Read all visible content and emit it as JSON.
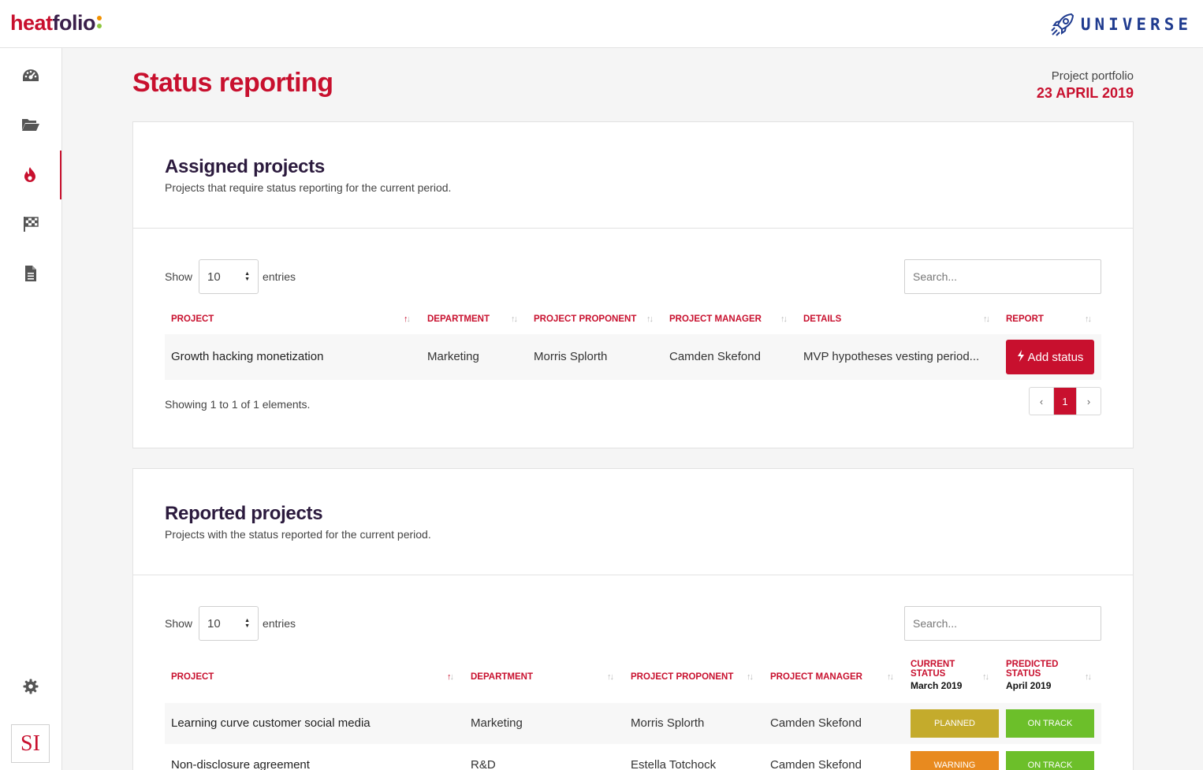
{
  "app": {
    "brand_a": "heat",
    "brand_b": "folio",
    "partner": "UNIVERSE",
    "accent": "#c8102e"
  },
  "sidebar": {
    "items": [
      {
        "icon": "dashboard-icon"
      },
      {
        "icon": "folder-icon"
      },
      {
        "icon": "fire-icon",
        "active": true
      },
      {
        "icon": "flag-icon"
      },
      {
        "icon": "document-icon"
      }
    ],
    "settings_icon": "gear-icon",
    "avatar_initials": "SI"
  },
  "header": {
    "title": "Status reporting",
    "portfolio_label": "Project portfolio",
    "date": "23 APRIL 2019"
  },
  "assigned": {
    "title": "Assigned projects",
    "subtitle": "Projects that require status reporting for the current period.",
    "show_label": "Show",
    "page_size": "10",
    "entries_label": "entries",
    "search_placeholder": "Search...",
    "columns": [
      "PROJECT",
      "DEPARTMENT",
      "PROJECT PROPONENT",
      "PROJECT MANAGER",
      "DETAILS",
      "REPORT"
    ],
    "rows": [
      {
        "project": "Growth hacking monetization",
        "department": "Marketing",
        "proponent": "Morris Splorth",
        "manager": "Camden Skefond",
        "details": "MVP hypotheses vesting period...",
        "action": "Add status"
      }
    ],
    "info": "Showing 1 to 1 of 1 elements.",
    "pager": {
      "prev": "‹",
      "page": "1",
      "next": "›"
    }
  },
  "reported": {
    "title": "Reported projects",
    "subtitle": "Projects with the status reported for the current period.",
    "show_label": "Show",
    "page_size": "10",
    "entries_label": "entries",
    "search_placeholder": "Search...",
    "columns": {
      "project": "PROJECT",
      "department": "DEPARTMENT",
      "proponent": "PROJECT PROPONENT",
      "manager": "PROJECT MANAGER",
      "current_a": "CURRENT",
      "current_b": "STATUS",
      "current_period": "March 2019",
      "predicted_a": "PREDICTED",
      "predicted_b": "STATUS",
      "predicted_period": "April 2019"
    },
    "rows": [
      {
        "project": "Learning curve customer social media",
        "department": "Marketing",
        "proponent": "Morris Splorth",
        "manager": "Camden Skefond",
        "current": "PLANNED",
        "current_color": "#c4ab2c",
        "predicted": "ON TRACK",
        "predicted_color": "#6cbf2a"
      },
      {
        "project": "Non-disclosure agreement",
        "department": "R&D",
        "proponent": "Estella Totchock",
        "manager": "Camden Skefond",
        "current": "WARNING",
        "current_color": "#e88a1f",
        "predicted": "ON TRACK",
        "predicted_color": "#6cbf2a"
      }
    ]
  }
}
